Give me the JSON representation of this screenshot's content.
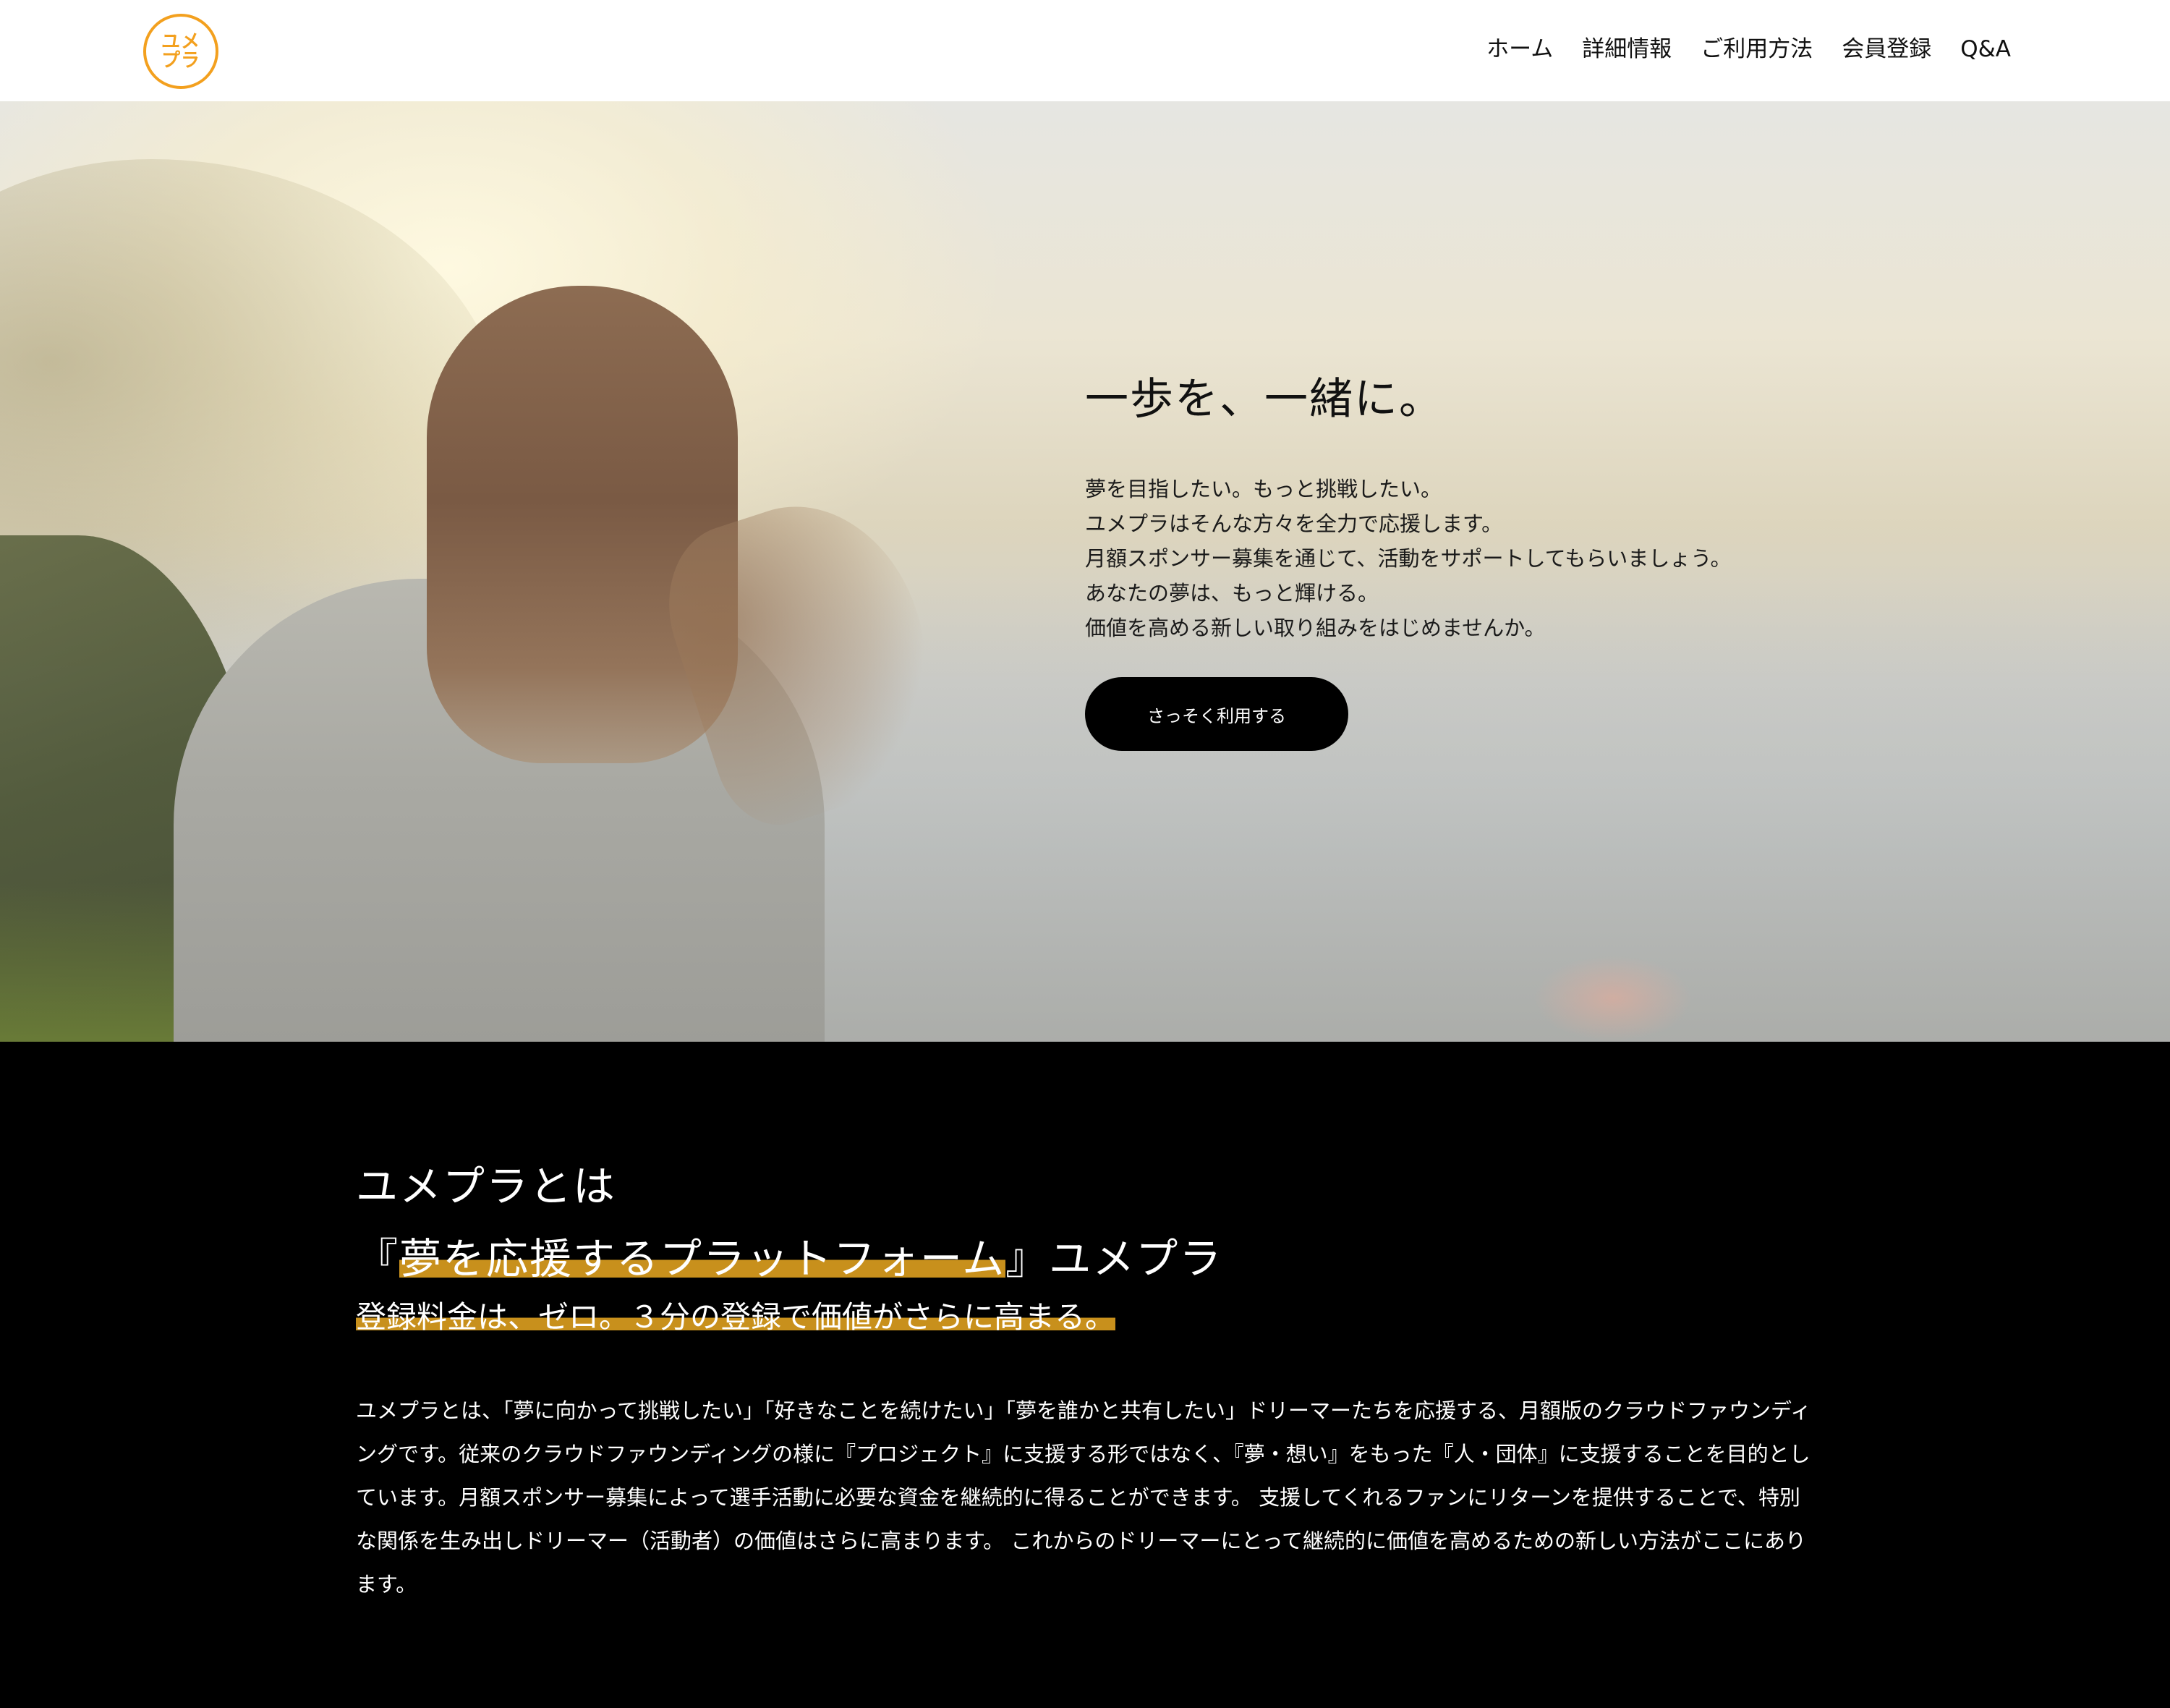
{
  "header": {
    "logo": {
      "line1": "ユメ",
      "line2": "プラ"
    },
    "nav": [
      {
        "label": "ホーム"
      },
      {
        "label": "詳細情報"
      },
      {
        "label": "ご利用方法"
      },
      {
        "label": "会員登録"
      },
      {
        "label": "Q&A"
      }
    ]
  },
  "hero": {
    "heading": "一歩を、一緒に。",
    "lines": [
      "夢を目指したい。もっと挑戦したい。",
      "ユメプラはそんな方々を全力で応援します。",
      "月額スポンサー募集を通じて、活動をサポートしてもらいましょう。",
      "あなたの夢は、もっと輝ける。",
      "価値を高める新しい取り組みをはじめませんか。"
    ],
    "cta_label": "さっそく利用する"
  },
  "about": {
    "title_line1": "ユメプラとは",
    "title_line2_open": "『",
    "title_line2_highlight": "夢を応援するプラットフォーム",
    "title_line2_close": "』ユメプラ",
    "subtitle": "登録料金は、ゼロ。３分の登録で価値がさらに高まる。",
    "body": "ユメプラとは、「夢に向かって挑戦したい」「好きなことを続けたい」「夢を誰かと共有したい」ドリーマーたちを応援する、月額版のクラウドファウンディングです。従来のクラウドファウンディングの様に『プロジェクト』に支援する形ではなく、『夢・想い』をもった『人・団体』に支援することを目的としています。月額スポンサー募集によって選手活動に必要な資金を継続的に得ることができます。 支援してくれるファンにリターンを提供することで、特別な関係を生み出しドリーマー（活動者）の価値はさらに高まります。 これからのドリーマーにとって継続的に価値を高めるための新しい方法がここにあります。"
  },
  "colors": {
    "brand_orange": "#f3a01e",
    "highlight_gold": "#c8901c",
    "section_bg": "#000000"
  }
}
